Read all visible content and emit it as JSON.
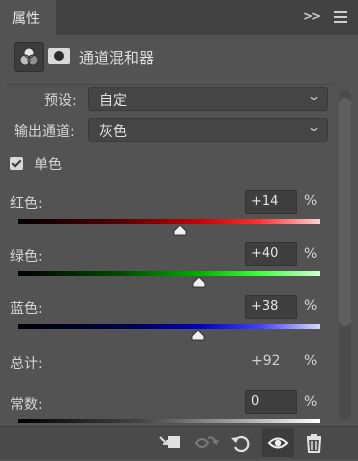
{
  "panel": {
    "tab_label": "属性",
    "title": "通道混和器"
  },
  "preset": {
    "label": "预设:",
    "value": "自定"
  },
  "output_channel": {
    "label": "输出通道:",
    "value": "灰色"
  },
  "monochrome": {
    "label": "单色",
    "checked": true
  },
  "channels": [
    {
      "label": "红色:",
      "value": "+14",
      "unit": "%",
      "slider_value": 14,
      "color": "#ff2a2a"
    },
    {
      "label": "绿色:",
      "value": "+40",
      "unit": "%",
      "slider_value": 40,
      "color": "#3cff3c"
    },
    {
      "label": "蓝色:",
      "value": "+38",
      "unit": "%",
      "slider_value": 38,
      "color": "#2a2aff"
    }
  ],
  "total": {
    "label": "总计:",
    "value": "+92",
    "unit": "%"
  },
  "constant": {
    "label": "常数:",
    "value": "0",
    "unit": "%",
    "slider_value": 0
  },
  "slider_range": [
    -200,
    200
  ],
  "footer_icons": [
    "clip-to-layer-icon",
    "view-previous-state-icon",
    "reset-icon",
    "visibility-eye-icon",
    "trash-icon"
  ],
  "colors": {
    "panel_bg": "#535353",
    "tabbar_bg": "#424242",
    "field_bg": "#454545",
    "accent_text": "#d6d6d6"
  }
}
